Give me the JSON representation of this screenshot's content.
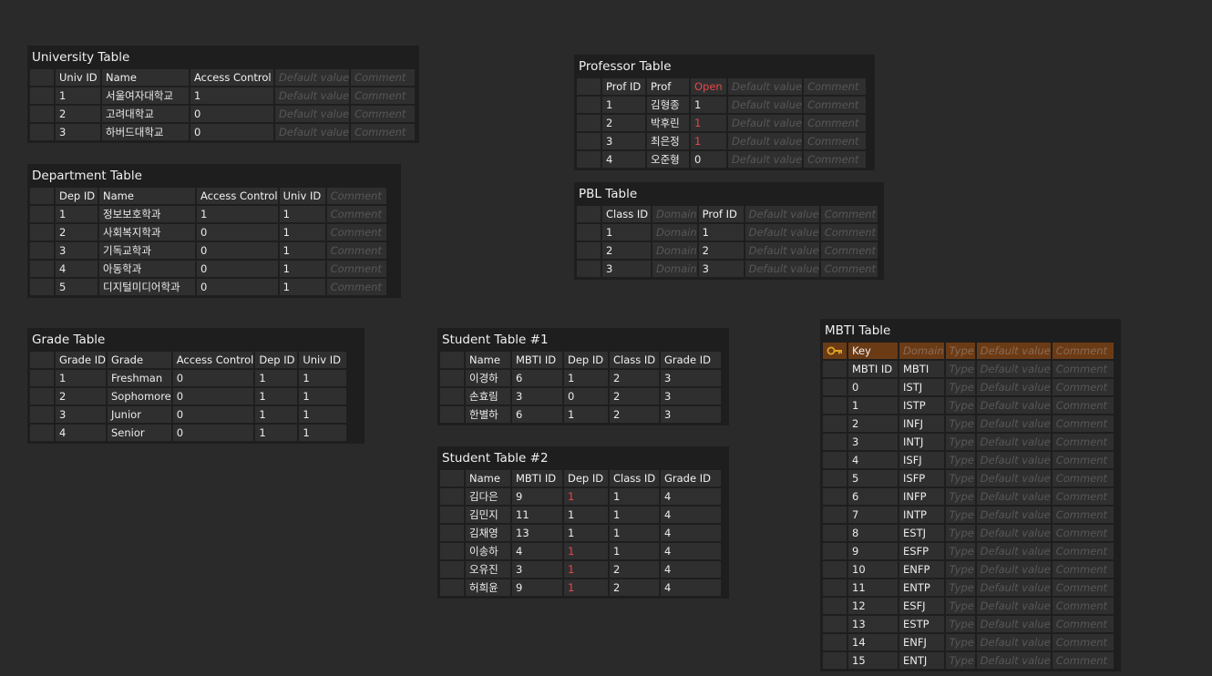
{
  "university": {
    "title": "University Table",
    "headers": [
      "Univ ID",
      "Name",
      "Access Control",
      "Default value",
      "Comment"
    ],
    "rows": [
      [
        "1",
        "서울여자대학교",
        "1",
        "Default value",
        "Comment"
      ],
      [
        "2",
        "고려대학교",
        "0",
        "Default value",
        "Comment"
      ],
      [
        "3",
        "하버드대학교",
        "0",
        "Default value",
        "Comment"
      ]
    ]
  },
  "department": {
    "title": "Department Table",
    "headers": [
      "Dep ID",
      "Name",
      "Access Control",
      "Univ ID",
      "Comment"
    ],
    "rows": [
      [
        "1",
        "정보보호학과",
        "1",
        "1",
        "Comment"
      ],
      [
        "2",
        "사회복지학과",
        "0",
        "1",
        "Comment"
      ],
      [
        "3",
        "기독교학과",
        "0",
        "1",
        "Comment"
      ],
      [
        "4",
        "아동학과",
        "0",
        "1",
        "Comment"
      ],
      [
        "5",
        "디지털미디어학과",
        "0",
        "1",
        "Comment"
      ]
    ]
  },
  "grade": {
    "title": "Grade Table",
    "headers": [
      "Grade ID",
      "Grade",
      "Access Control",
      "Dep ID",
      "Univ ID"
    ],
    "rows": [
      [
        "1",
        "Freshman",
        "0",
        "1",
        "1"
      ],
      [
        "2",
        "Sophomore",
        "0",
        "1",
        "1"
      ],
      [
        "3",
        "Junior",
        "0",
        "1",
        "1"
      ],
      [
        "4",
        "Senior",
        "0",
        "1",
        "1"
      ]
    ]
  },
  "professor": {
    "title": "Professor Table",
    "headers": [
      "Prof ID",
      "Prof",
      "Open",
      "Default value",
      "Comment"
    ],
    "rows": [
      [
        "1",
        "김형종",
        "1",
        "Default value",
        "Comment"
      ],
      [
        "2",
        "박후린",
        "1",
        "Default value",
        "Comment"
      ],
      [
        "3",
        "최은정",
        "1",
        "Default value",
        "Comment"
      ],
      [
        "4",
        "오준형",
        "0",
        "Default value",
        "Comment"
      ]
    ]
  },
  "pbl": {
    "title": "PBL Table",
    "headers": [
      "Class ID",
      "Domain",
      "Prof ID",
      "Default value",
      "Comment"
    ],
    "rows": [
      [
        "1",
        "Domain",
        "1",
        "Default value",
        "Comment"
      ],
      [
        "2",
        "Domain",
        "2",
        "Default value",
        "Comment"
      ],
      [
        "3",
        "Domain",
        "3",
        "Default value",
        "Comment"
      ]
    ]
  },
  "student1": {
    "title": "Student Table #1",
    "headers": [
      "Name",
      "MBTI ID",
      "Dep ID",
      "Class ID",
      "Grade ID"
    ],
    "rows": [
      [
        "이경하",
        "6",
        "1",
        "2",
        "3"
      ],
      [
        "손효림",
        "3",
        "0",
        "2",
        "3"
      ],
      [
        "한별하",
        "6",
        "1",
        "2",
        "3"
      ]
    ]
  },
  "student2": {
    "title": "Student Table #2",
    "headers": [
      "Name",
      "MBTI ID",
      "Dep ID",
      "Class ID",
      "Grade ID"
    ],
    "rows": [
      [
        "김다은",
        "9",
        "1",
        "1",
        "4"
      ],
      [
        "김민지",
        "11",
        "1",
        "1",
        "4"
      ],
      [
        "김채영",
        "13",
        "1",
        "1",
        "4"
      ],
      [
        "이송하",
        "4",
        "1",
        "1",
        "4"
      ],
      [
        "오유진",
        "3",
        "1",
        "2",
        "4"
      ],
      [
        "허희윤",
        "9",
        "1",
        "2",
        "4"
      ]
    ]
  },
  "mbti": {
    "title": "MBTI Table",
    "key_row": [
      "Key",
      "Domain",
      "Type",
      "Default value",
      "Comment"
    ],
    "headers": [
      "MBTI ID",
      "MBTI",
      "Type",
      "Default value",
      "Comment"
    ],
    "rows": [
      [
        "0",
        "ISTJ",
        "Type",
        "Default value",
        "Comment"
      ],
      [
        "1",
        "ISTP",
        "Type",
        "Default value",
        "Comment"
      ],
      [
        "2",
        "INFJ",
        "Type",
        "Default value",
        "Comment"
      ],
      [
        "3",
        "INTJ",
        "Type",
        "Default value",
        "Comment"
      ],
      [
        "4",
        "ISFJ",
        "Type",
        "Default value",
        "Comment"
      ],
      [
        "5",
        "ISFP",
        "Type",
        "Default value",
        "Comment"
      ],
      [
        "6",
        "INFP",
        "Type",
        "Default value",
        "Comment"
      ],
      [
        "7",
        "INTP",
        "Type",
        "Default value",
        "Comment"
      ],
      [
        "8",
        "ESTJ",
        "Type",
        "Default value",
        "Comment"
      ],
      [
        "9",
        "ESFP",
        "Type",
        "Default value",
        "Comment"
      ],
      [
        "10",
        "ENFP",
        "Type",
        "Default value",
        "Comment"
      ],
      [
        "11",
        "ENTP",
        "Type",
        "Default value",
        "Comment"
      ],
      [
        "12",
        "ESFJ",
        "Type",
        "Default value",
        "Comment"
      ],
      [
        "13",
        "ESTP",
        "Type",
        "Default value",
        "Comment"
      ],
      [
        "14",
        "ENFJ",
        "Type",
        "Default value",
        "Comment"
      ],
      [
        "15",
        "ENTJ",
        "Type",
        "Default value",
        "Comment"
      ]
    ]
  },
  "colors": {
    "background": "#2a2a2a",
    "panel": "#1e1e1e",
    "cell": "#2f2f2f",
    "highlight": "#e8474b",
    "key_row": "#6b3b16",
    "key_icon": "#e0a526"
  },
  "icons": {
    "key": "key-icon"
  }
}
